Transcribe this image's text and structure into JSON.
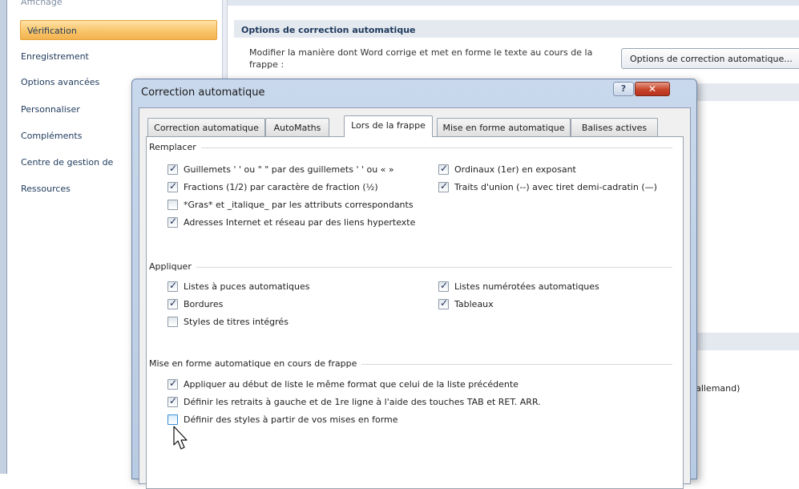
{
  "sidebar": {
    "cut_item": "Affichage",
    "selected": "Vérification",
    "items": [
      "Enregistrement",
      "Options avancées",
      "Personnaliser",
      "Compléments",
      "Centre de gestion de",
      "Ressources"
    ]
  },
  "main": {
    "section_title": "Options de correction automatique",
    "description": "Modifier la manière dont Word corrige et met en forme le texte au cours de la frappe :",
    "autocorrect_button": "Options de correction automatique...",
    "partial_text": "l'allemand)"
  },
  "dialog": {
    "title": "Correction automatique",
    "help": "?",
    "close": "✕",
    "tabs": [
      {
        "label": "Correction automatique",
        "active": false
      },
      {
        "label": "AutoMaths",
        "active": false
      },
      {
        "label": "Lors de la frappe",
        "active": true
      },
      {
        "label": "Mise en forme automatique",
        "active": false
      },
      {
        "label": "Balises actives",
        "active": false
      }
    ],
    "groups": {
      "replace": {
        "label": "Remplacer",
        "items": [
          {
            "label": "Guillemets ' ' ou \" \" par des guillemets ' ' ou « »",
            "checked": true
          },
          {
            "label": "Ordinaux (1er) en exposant",
            "checked": true
          },
          {
            "label": "Fractions (1/2) par caractère de fraction (½)",
            "checked": true
          },
          {
            "label": "Traits d'union (--) avec tiret demi-cadratin (—)",
            "checked": true
          },
          {
            "label": "*Gras* et _italique_ par les attributs correspondants",
            "checked": false
          },
          {
            "label": "Adresses Internet et réseau par des liens hypertexte",
            "checked": true
          }
        ]
      },
      "apply": {
        "label": "Appliquer",
        "items": [
          {
            "label": "Listes à puces automatiques",
            "checked": true
          },
          {
            "label": "Listes numérotées automatiques",
            "checked": true
          },
          {
            "label": "Bordures",
            "checked": true
          },
          {
            "label": "Tableaux",
            "checked": true
          },
          {
            "label": "Styles de titres intégrés",
            "checked": false
          }
        ]
      },
      "format": {
        "label": "Mise en forme automatique en cours de frappe",
        "items": [
          {
            "label": "Appliquer au début de liste le même format que celui de la liste précédente",
            "checked": true
          },
          {
            "label": "Définir les retraits à gauche et de 1re ligne à l'aide des touches TAB et RET. ARR.",
            "checked": true
          },
          {
            "label": "Définir des styles à partir de vos mises en forme",
            "checked": false
          }
        ]
      }
    }
  },
  "icons": {
    "cursor": "mouse-pointer-icon",
    "check": "checkmark-icon"
  },
  "colors": {
    "selected_item": "#f8c56b",
    "title_bar": "#c9d8ec",
    "close_button": "#c6452a"
  }
}
